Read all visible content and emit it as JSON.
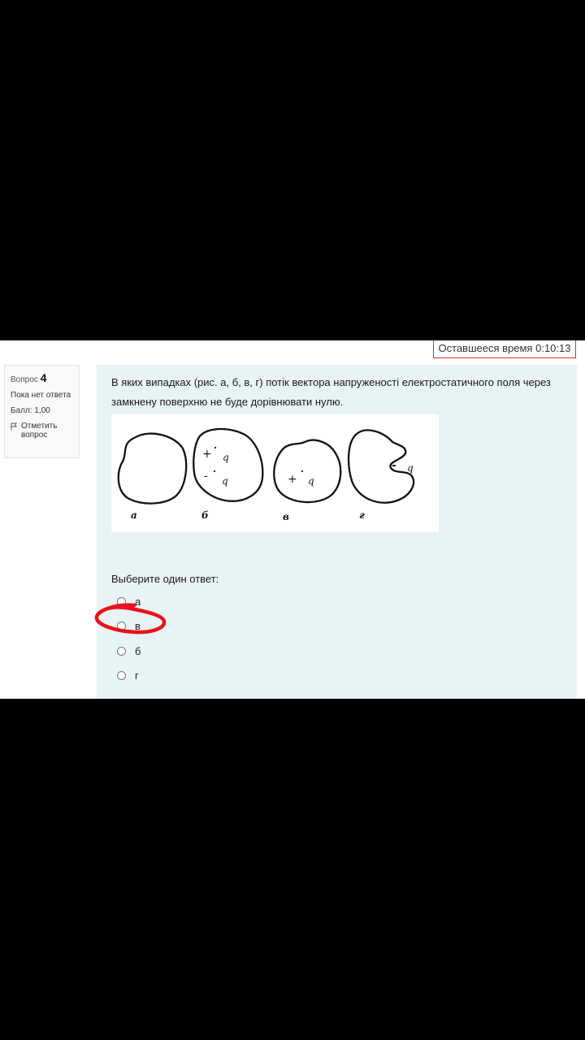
{
  "timer": {
    "text": "Оставшееся время 0:10:13"
  },
  "info": {
    "question_label": "Вопрос",
    "question_number": "4",
    "status": "Пока нет ответа",
    "score": "Балл: 1,00",
    "flag_label": "Отметить вопрос",
    "flag_icon": "flag-icon"
  },
  "question": {
    "text": "В яких випадках (рис. а, б, в, г) потік вектора напруженості електростатичного поля через замкнену поверхню не буде дорівнювати нулю.",
    "figure": {
      "labels": [
        "а",
        "б",
        "в",
        "г"
      ],
      "charge_signs": [
        "+",
        "-",
        "+",
        "-"
      ],
      "charge_symbol": "q"
    }
  },
  "answer": {
    "prompt": "Выберите один ответ:",
    "options": [
      "а",
      "в",
      "б",
      "г"
    ],
    "highlighted_option": "в",
    "highlight_color": "#e8121a"
  }
}
